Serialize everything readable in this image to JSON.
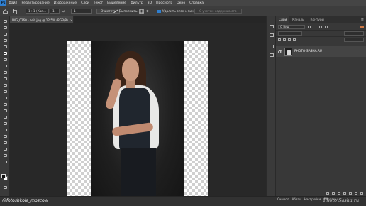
{
  "menubar": {
    "logo": "Ps",
    "items": [
      "Файл",
      "Редактирование",
      "Изображение",
      "Слои",
      "Текст",
      "Выделение",
      "Фильтр",
      "3D",
      "Просмотр",
      "Окно",
      "Справка"
    ]
  },
  "options": {
    "ratio_value": "1 : 1 (Ква...",
    "width_value": "1",
    "height_value": "1",
    "clear_label": "Очистить",
    "straighten_label": "Выпрямить",
    "delete_cropped_label": "Удалить отсеч. пикс.",
    "content_aware_label": "С учетом содержимого"
  },
  "document": {
    "tab_title": "IMG_0260 - edit.jpg @ 12,5% (RGB/8)",
    "close_glyph": "×"
  },
  "canvas": {
    "cursor_glyph": "⌖"
  },
  "layers_panel": {
    "tabs": [
      "Слои",
      "Каналы",
      "Контуры"
    ],
    "menu_glyph": "≡",
    "kind_label": "Q Вид",
    "layers": [
      {
        "name": "PHOTO-SASHA.RU",
        "visible": true
      }
    ]
  },
  "status": {
    "watermark_left": "@fotoshkola_moscow",
    "watermark_right": "Photo Sasha ru"
  },
  "bottom_panel": {
    "tabs": [
      "Символ",
      "Абзац",
      "Настройки",
      "Образцы"
    ]
  }
}
